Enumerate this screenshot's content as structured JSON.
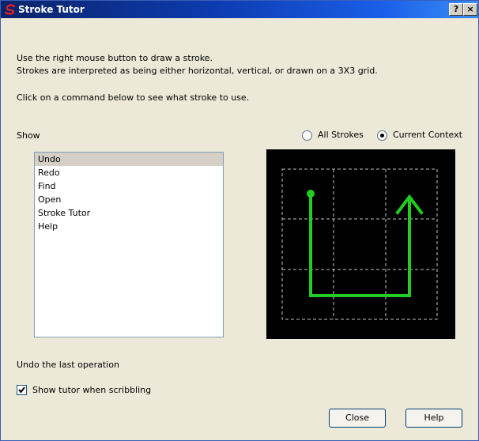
{
  "window": {
    "title": "Stroke Tutor",
    "help_glyph": "?",
    "close_glyph": "×"
  },
  "instructions": {
    "line1": "Use the right mouse button to draw a stroke.",
    "line2": "Strokes are interpreted as being either horizontal, vertical, or drawn on a 3X3 grid.",
    "line3": "Click on a command below to see what stroke to use."
  },
  "show": {
    "label": "Show",
    "options": [
      {
        "label": "All Strokes",
        "selected": false
      },
      {
        "label": "Current Context",
        "selected": true
      }
    ]
  },
  "commands": {
    "items": [
      "Undo",
      "Redo",
      "Find",
      "Open",
      "Stroke Tutor",
      "Help"
    ],
    "selected_index": 0
  },
  "stroke_preview": {
    "grid": "3x3",
    "stroke_color": "#22cc22",
    "grid_color": "#c0c0c0",
    "background": "#000000"
  },
  "status_text": "Undo the last operation",
  "tutor_checkbox": {
    "label": "Show tutor when scribbling",
    "checked": true
  },
  "buttons": {
    "close": "Close",
    "help": "Help"
  }
}
